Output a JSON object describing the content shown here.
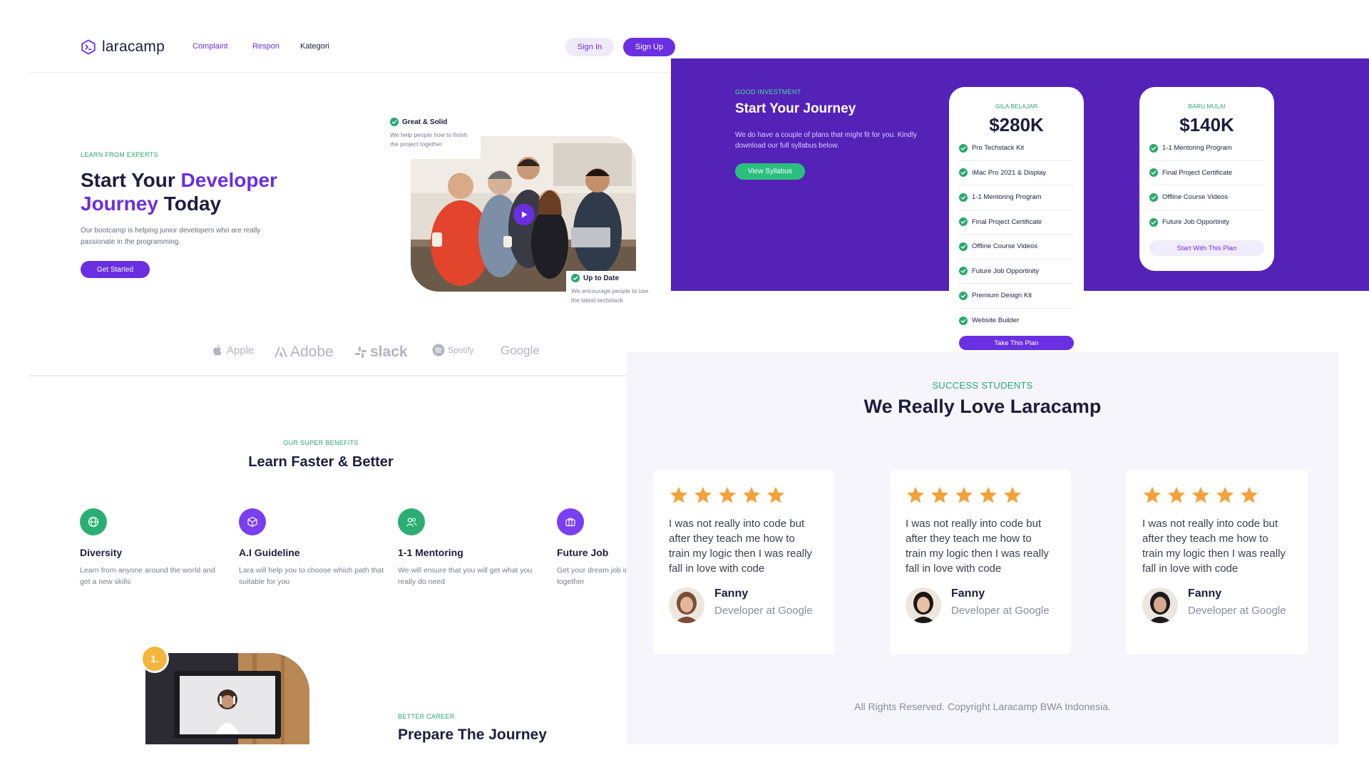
{
  "header": {
    "logo_text": "laracamp",
    "nav": [
      "Complaint",
      "Respon",
      "Kategori"
    ],
    "signin_label": "Sign In",
    "signup_label": "Sign Up"
  },
  "hero": {
    "eyebrow": "LEARN FROM EXPERTS",
    "title_part1": "Start Your ",
    "title_highlight1": "Developer",
    "title_highlight2": "Journey",
    "title_part2": " Today",
    "description": "Our bootcamp is helping junior developers who are really passionate in the programming.",
    "cta_label": "Get Started",
    "badge1_title": "Great & Solid",
    "badge1_desc": "We help people how to finish the project together",
    "badge2_title": "Up to Date",
    "badge2_desc": "We encourage people to use the latest techstack"
  },
  "brands": [
    "Apple",
    "Adobe",
    "slack",
    "Spotify",
    "Google"
  ],
  "benefits": {
    "eyebrow": "OUR SUPER BENEFITS",
    "title": "Learn Faster & Better",
    "items": [
      {
        "title": "Diversity",
        "desc": "Learn from anyone around the world and get a new skills",
        "icon": "globe-icon",
        "color": "#2bae74"
      },
      {
        "title": "A.I Guideline",
        "desc": "Lara will help you to choose which path that suitable for you",
        "icon": "cube-icon",
        "color": "#7a3ff0"
      },
      {
        "title": "1-1 Mentoring",
        "desc": "We will ensure that you will get what you really do need",
        "icon": "users-icon",
        "color": "#2bae74"
      },
      {
        "title": "Future Job",
        "desc": "Get your dream job in any company together",
        "icon": "briefcase-icon",
        "color": "#7a3ff0"
      }
    ]
  },
  "career": {
    "step": "1.",
    "eyebrow": "BETTER CAREER",
    "title": "Prepare The Journey"
  },
  "pricing": {
    "eyebrow": "GOOD INVESTMENT",
    "title": "Start Your Journey",
    "description": "We do have a couple of plans that might fit for you. Kindly download our full syllabus below.",
    "syllabus_label": "View Syllabus",
    "plans": [
      {
        "tag": "GILA BELAJAR",
        "price": "$280K",
        "features": [
          "Pro Techstack Kit",
          "iMac Pro 2021 & Display",
          "1-1 Mentoring Program",
          "Final Project Certificate",
          "Offline Course Videos",
          "Future Job Opportinity",
          "Premium Design Kit",
          "Website Builder"
        ],
        "button": "Take This Plan"
      },
      {
        "tag": "BARU MULAI",
        "price": "$140K",
        "features": [
          "1-1 Mentoring Program",
          "Final Project Certificate",
          "Offline Course Videos",
          "Future Job Opportinity"
        ],
        "button": "Start With This Plan"
      }
    ]
  },
  "testimonials": {
    "eyebrow": "SUCCESS STUDENTS",
    "title": "We Really Love Laracamp",
    "rating": 5,
    "items": [
      {
        "quote": "I was not really into code but after they teach me how to train my logic then I was really fall in love with code",
        "name": "Fanny",
        "role": "Developer at Google"
      },
      {
        "quote": "I was not really into code but after they teach me how to train my logic then I was really fall in love with code",
        "name": "Fanny",
        "role": "Developer at Google"
      },
      {
        "quote": "I was not really into code but after they teach me how to train my logic then I was really fall in love with code",
        "name": "Fanny",
        "role": "Developer at Google"
      }
    ]
  },
  "footer": {
    "copyright": "All Rights Reserved. Copyright Laracamp BWA Indonesia."
  },
  "colors": {
    "primary": "#6a2fe0",
    "pricing_bg": "#5522b8",
    "accent_green": "#27a96b",
    "star": "#f5a13a"
  }
}
